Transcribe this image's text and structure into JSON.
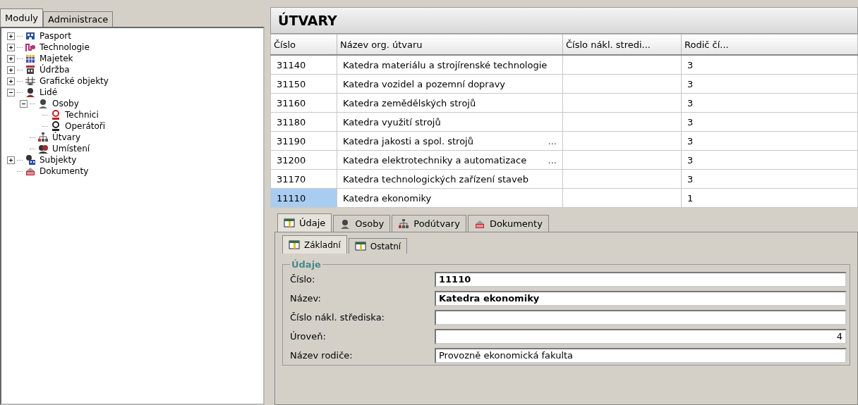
{
  "left_tabs": [
    {
      "label": "Moduly",
      "selected": true
    },
    {
      "label": "Administrace",
      "selected": false
    }
  ],
  "tree": [
    {
      "label": "Pasport",
      "expanded": false
    },
    {
      "label": "Technologie",
      "expanded": false
    },
    {
      "label": "Majetek",
      "expanded": false
    },
    {
      "label": "Údržba",
      "expanded": false
    },
    {
      "label": "Grafické objekty",
      "expanded": false
    },
    {
      "label": "Lidé",
      "expanded": true,
      "children": [
        {
          "label": "Osoby",
          "expanded": true,
          "children": [
            {
              "label": "Technici"
            },
            {
              "label": "Operátoři"
            }
          ]
        },
        {
          "label": "Útvary"
        },
        {
          "label": "Umístení"
        }
      ]
    },
    {
      "label": "Subjekty",
      "expanded": false
    },
    {
      "label": "Dokumenty"
    }
  ],
  "title": "ÚTVARY",
  "table": {
    "columns": [
      "Číslo",
      "Název org. útvaru",
      "Číslo nákl. stredi...",
      "Rodič čí..."
    ],
    "rows": [
      {
        "cells": [
          "31140",
          "Katedra materiálu a strojírenské technologie",
          "",
          "3"
        ],
        "selected": false
      },
      {
        "cells": [
          "31150",
          "Katedra vozidel a pozemní dopravy",
          "",
          "3"
        ],
        "selected": false
      },
      {
        "cells": [
          "31160",
          "Katedra zemědělských strojů",
          "",
          "3"
        ],
        "selected": false
      },
      {
        "cells": [
          "31180",
          "Katedra využití strojů",
          "",
          "3"
        ],
        "selected": false
      },
      {
        "cells": [
          "31190",
          "Katedra jakosti a spol. strojů",
          "",
          "3"
        ],
        "note": "...",
        "selected": false
      },
      {
        "cells": [
          "31200",
          "Katedra elektrotechniky a automatizace",
          "",
          "3"
        ],
        "note": "...",
        "selected": false
      },
      {
        "cells": [
          "31170",
          "Katedra technologických zařízení staveb",
          "",
          "3"
        ],
        "selected": false
      },
      {
        "cells": [
          "11110",
          "Katedra ekonomiky",
          "",
          "1"
        ],
        "selected": true
      }
    ]
  },
  "detail_tabs": [
    {
      "label": "Údaje",
      "selected": true
    },
    {
      "label": "Osoby",
      "selected": false
    },
    {
      "label": "Podútvary",
      "selected": false
    },
    {
      "label": "Dokumenty",
      "selected": false
    }
  ],
  "sub_tabs": [
    {
      "label": "Základní",
      "selected": true
    },
    {
      "label": "Ostatní",
      "selected": false
    }
  ],
  "group": {
    "title": "Údaje",
    "fields": [
      {
        "label": "Číslo:",
        "value": "11110",
        "bold": true,
        "numeric": false
      },
      {
        "label": "Název:",
        "value": "Katedra ekonomiky",
        "bold": true,
        "numeric": false
      },
      {
        "label": "Číslo nákl. střediska:"
      },
      {
        "label": "Úroveň:",
        "value": "4",
        "bold": false,
        "numeric": true
      },
      {
        "label": "Název rodiče:",
        "value": "Provozně ekonomická fakulta",
        "bold": false,
        "numeric": false
      }
    ]
  }
}
